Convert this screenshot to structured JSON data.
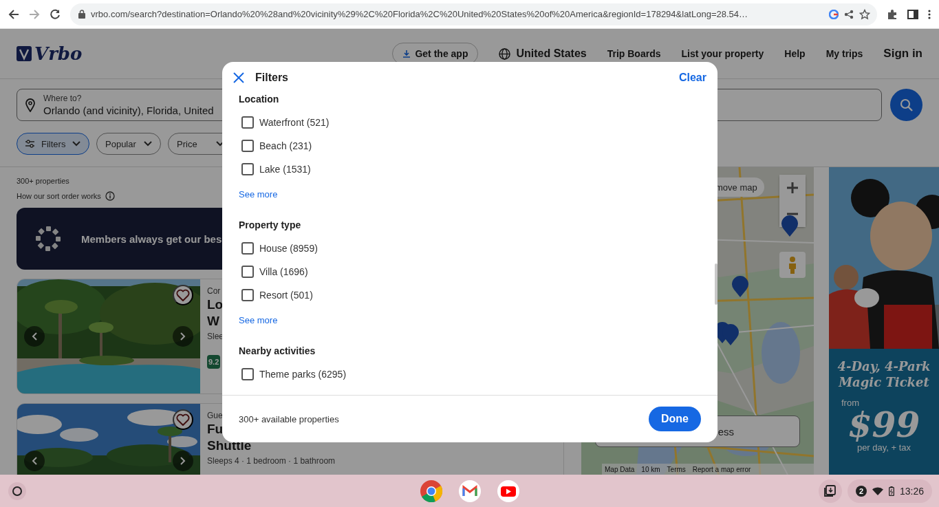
{
  "browser": {
    "url": "vrbo.com/search?destination=Orlando%20%28and%20vicinity%29%2C%20Florida%2C%20United%20States%20of%20America&regionId=178294&latLong=28.54…"
  },
  "header": {
    "logo": "Vrbo",
    "get_app": "Get the app",
    "region": "United States",
    "links": [
      "Trip Boards",
      "List your property",
      "Help",
      "My trips"
    ],
    "sign_in": "Sign in"
  },
  "search": {
    "label": "Where to?",
    "value": "Orlando (and vicinity), Florida, United"
  },
  "chips": [
    {
      "label": "Filters",
      "selected": true
    },
    {
      "label": "Popular",
      "selected": false
    },
    {
      "label": "Price",
      "selected": false
    }
  ],
  "results": {
    "count": "300+ properties",
    "sort_info": "How our sort order works",
    "banner": "Members always get our bes"
  },
  "cards": [
    {
      "kind": "pool",
      "category": "Cor",
      "title_lines": [
        "Lo",
        "W"
      ],
      "details": "Slee",
      "rating": "9.2"
    },
    {
      "kind": "sky",
      "category": "Gue",
      "title_lines": [
        "Fu",
        "Shuttle"
      ],
      "details": "Sleeps 4 · 1 bedroom · 1 bathroom"
    }
  ],
  "map": {
    "move_button": "move map",
    "address_field": "ess",
    "map_data": "Map Data",
    "scale": "10 km",
    "terms": "Terms",
    "report": "Report a map error"
  },
  "ad": {
    "headline": "4-Day, 4-Park Magic Ticket",
    "from": "from",
    "price": "$99",
    "unit": "per day, + tax"
  },
  "modal": {
    "title": "Filters",
    "clear": "Clear",
    "sections": [
      {
        "heading": "Location",
        "options": [
          {
            "label": "Waterfront (521)",
            "checked": false
          },
          {
            "label": "Beach (231)",
            "checked": false
          },
          {
            "label": "Lake (1531)",
            "checked": false
          }
        ],
        "more": "See more"
      },
      {
        "heading": "Property type",
        "options": [
          {
            "label": "House (8959)",
            "checked": false
          },
          {
            "label": "Villa (1696)",
            "checked": false
          },
          {
            "label": "Resort (501)",
            "checked": false
          }
        ],
        "more": "See more"
      },
      {
        "heading": "Nearby activities",
        "options": [
          {
            "label": "Theme parks (6295)",
            "checked": false
          }
        ]
      }
    ],
    "summary": "300+ available properties",
    "done": "Done"
  },
  "taskbar": {
    "notifications": "2",
    "time": "13:26"
  }
}
